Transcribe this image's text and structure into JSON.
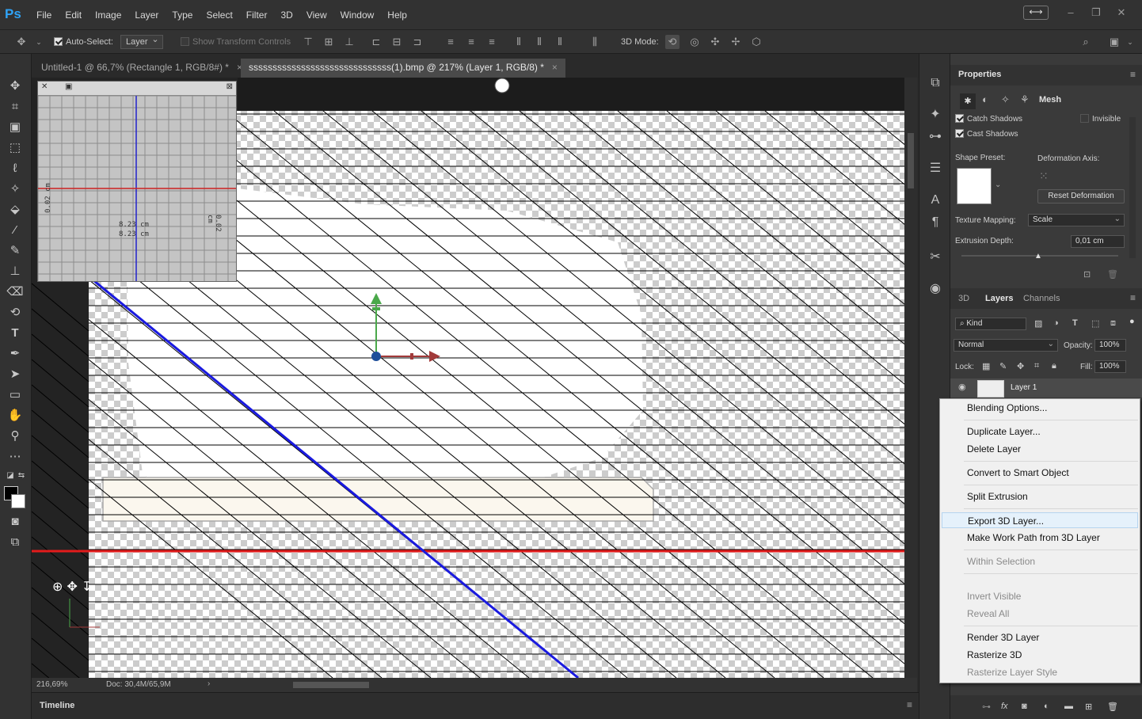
{
  "app": {
    "logo": "Ps"
  },
  "menubar": {
    "items": [
      "File",
      "Edit",
      "Image",
      "Layer",
      "Type",
      "Select",
      "Filter",
      "3D",
      "View",
      "Window",
      "Help"
    ]
  },
  "options": {
    "auto_select_label": "Auto-Select:",
    "auto_select_value": "Layer",
    "show_transform_label": "Show Transform Controls",
    "mode_label": "3D Mode:"
  },
  "tabs": [
    {
      "label": "Untitled-1 @ 66,7% (Rectangle 1, RGB/8#) *",
      "active": false
    },
    {
      "label": "ssssssssssssssssssssssssssssss(1).bmp @ 217% (Layer 1, RGB/8) *",
      "active": true
    }
  ],
  "navigator": {
    "left_label": "0.02 cm",
    "right_label": "0.02 cm",
    "center_label_1": "8.23 cm",
    "center_label_2": "8.23 cm"
  },
  "status": {
    "zoom": "216,69%",
    "doc": "Doc: 30,4M/65,9M"
  },
  "timeline": {
    "label": "Timeline"
  },
  "properties": {
    "title": "Properties",
    "mesh_label": "Mesh",
    "catch_shadows": "Catch Shadows",
    "cast_shadows": "Cast Shadows",
    "invisible": "Invisible",
    "shape_preset": "Shape Preset:",
    "deformation_axis": "Deformation Axis:",
    "reset_deformation": "Reset Deformation",
    "texture_mapping_label": "Texture Mapping:",
    "texture_mapping_value": "Scale",
    "extrusion_label": "Extrusion Depth:",
    "extrusion_value": "0,01 cm"
  },
  "layers": {
    "tabs": [
      "3D",
      "Layers",
      "Channels"
    ],
    "active_tab": "Layers",
    "kind": "Kind",
    "blend_mode": "Normal",
    "opacity_label": "Opacity:",
    "opacity_value": "100%",
    "lock_label": "Lock:",
    "fill_label": "Fill:",
    "fill_value": "100%",
    "layer_name": "Layer 1"
  },
  "context_menu": {
    "items": [
      {
        "label": "Blending Options...",
        "disabled": false
      },
      {
        "label": "Duplicate Layer...",
        "disabled": false
      },
      {
        "label": "Delete Layer",
        "disabled": false
      },
      {
        "label": "Convert to Smart Object",
        "disabled": false
      },
      {
        "label": "Split Extrusion",
        "disabled": false
      },
      {
        "label": "Export 3D Layer...",
        "disabled": false,
        "hover": true
      },
      {
        "label": "Make Work Path from 3D Layer",
        "disabled": false
      },
      {
        "label": "Within Selection",
        "disabled": true
      },
      {
        "label": "Invert Visible",
        "disabled": true
      },
      {
        "label": "Reveal All",
        "disabled": true
      },
      {
        "label": "Render 3D Layer",
        "disabled": false
      },
      {
        "label": "Rasterize 3D",
        "disabled": false
      },
      {
        "label": "Rasterize Layer Style",
        "disabled": true
      }
    ]
  },
  "colors": {
    "accent_blue": "#2fa3f6",
    "guide_red": "#e21b1b",
    "guide_blue": "#1a1adf",
    "gizmo_green": "#4aa84a",
    "gizmo_red": "#a23a3a"
  }
}
